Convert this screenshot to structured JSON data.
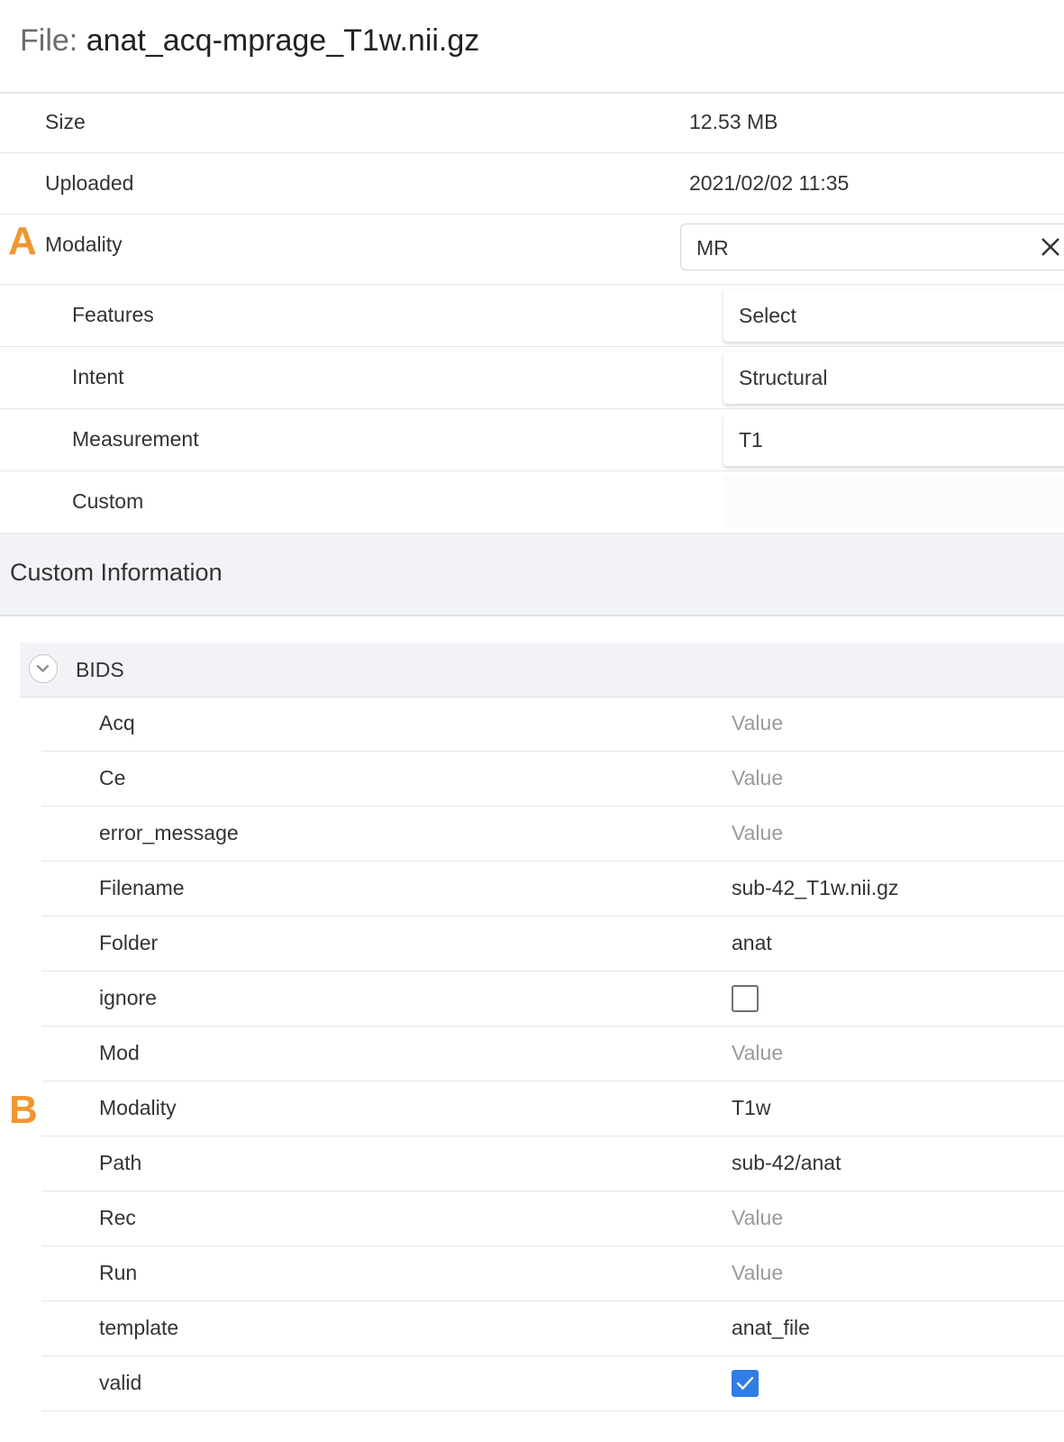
{
  "header": {
    "prefix": "File: ",
    "filename": "anat_acq-mprage_T1w.nii.gz"
  },
  "info": {
    "size_label": "Size",
    "size_value": "12.53 MB",
    "uploaded_label": "Uploaded",
    "uploaded_value": "2021/02/02 11:35",
    "modality_label": "Modality",
    "modality_value": "MR",
    "features_label": "Features",
    "features_value": "Select",
    "intent_label": "Intent",
    "intent_value": "Structural",
    "measurement_label": "Measurement",
    "measurement_value": "T1",
    "custom_label": "Custom"
  },
  "markers": {
    "a": "A",
    "b": "B"
  },
  "custom_info": {
    "title": "Custom Information",
    "group_title": "BIDS",
    "rows": [
      {
        "key": "Acq",
        "value": "Value",
        "placeholder": true
      },
      {
        "key": "Ce",
        "value": "Value",
        "placeholder": true
      },
      {
        "key": "error_message",
        "value": "Value",
        "placeholder": true
      },
      {
        "key": "Filename",
        "value": "sub-42_T1w.nii.gz",
        "placeholder": false
      },
      {
        "key": "Folder",
        "value": "anat",
        "placeholder": false
      },
      {
        "key": "ignore",
        "checkbox": false
      },
      {
        "key": "Mod",
        "value": "Value",
        "placeholder": true
      },
      {
        "key": "Modality",
        "value": "T1w",
        "placeholder": false
      },
      {
        "key": "Path",
        "value": "sub-42/anat",
        "placeholder": false
      },
      {
        "key": "Rec",
        "value": "Value",
        "placeholder": true
      },
      {
        "key": "Run",
        "value": "Value",
        "placeholder": true
      },
      {
        "key": "template",
        "value": "anat_file",
        "placeholder": false
      },
      {
        "key": "valid",
        "checkbox": true
      }
    ]
  },
  "colors": {
    "accent_marker": "#f0962f",
    "checkbox_checked": "#2f7ee6",
    "section_bg": "#f1f3f6"
  }
}
